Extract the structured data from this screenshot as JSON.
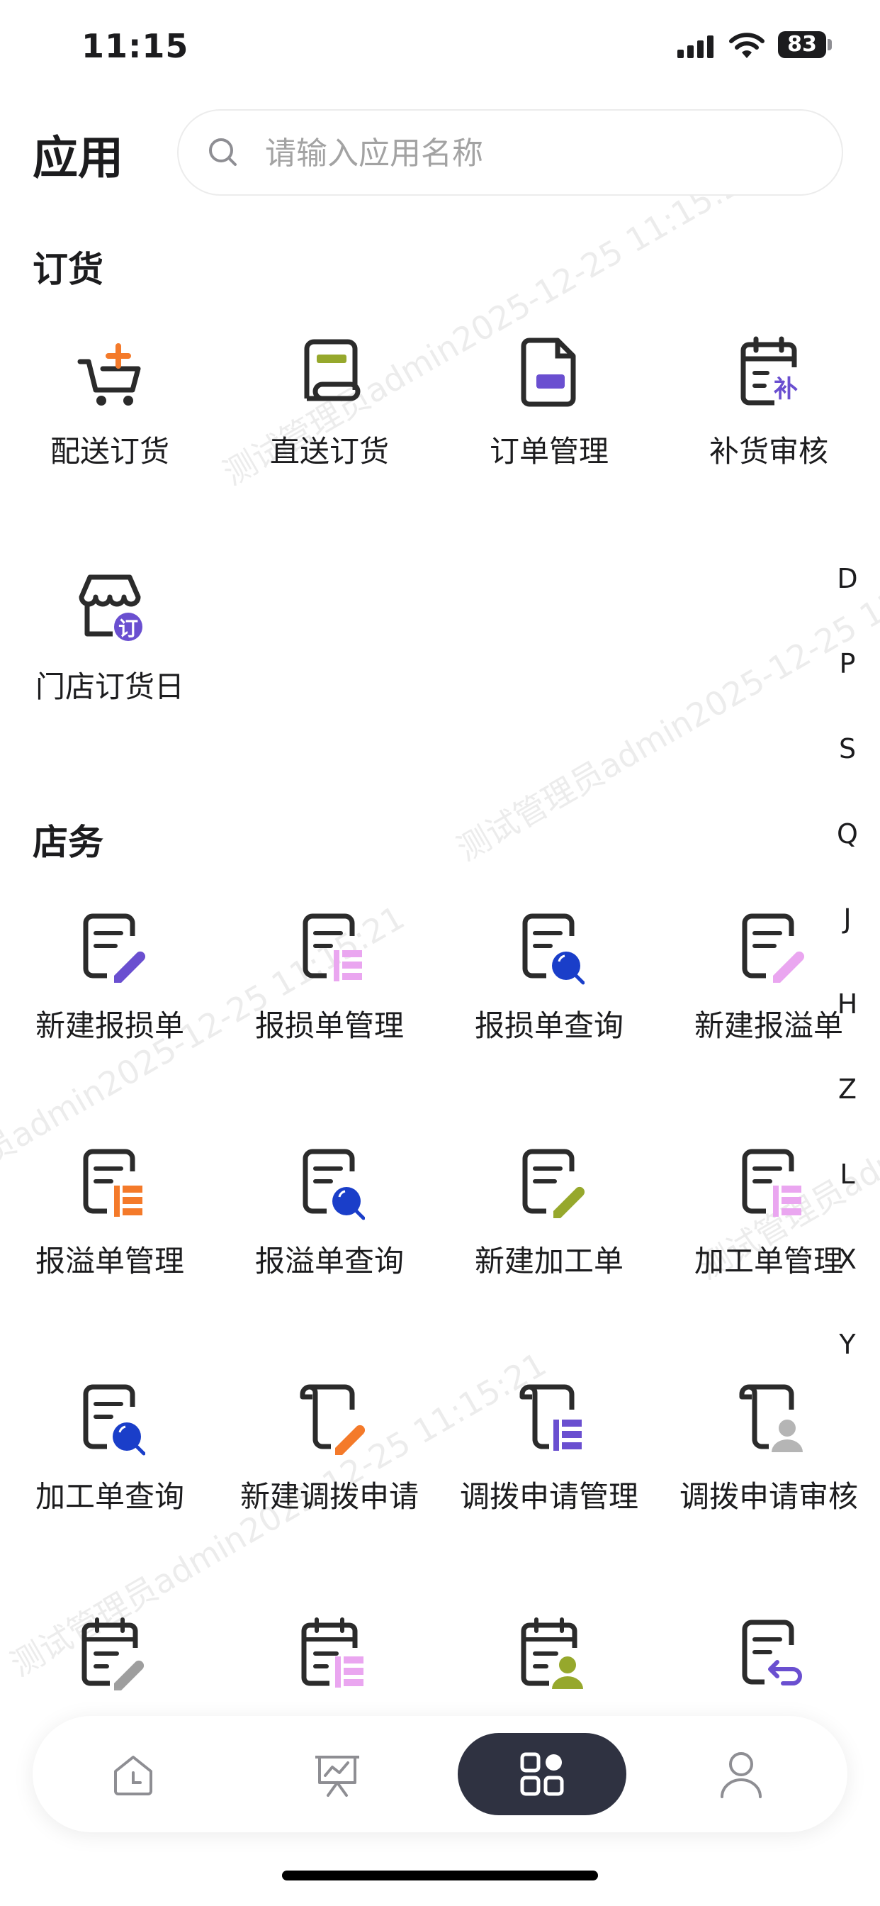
{
  "status_bar": {
    "time": "11:15",
    "battery": "83"
  },
  "header": {
    "title": "应用",
    "search_placeholder": "请输入应用名称"
  },
  "sections": [
    {
      "title": "订货",
      "apps": [
        "配送订货",
        "直送订货",
        "订单管理",
        "补货审核",
        "门店订货日"
      ]
    },
    {
      "title": "店务",
      "apps": [
        "新建报损单",
        "报损单管理",
        "报损单查询",
        "新建报溢单",
        "报溢单管理",
        "报溢单查询",
        "新建加工单",
        "加工单管理",
        "加工单查询",
        "新建调拨申请",
        "调拨申请管理",
        "调拨申请审核"
      ]
    }
  ],
  "icon_badges": {
    "replenish": "补",
    "order_day": "订"
  },
  "alphabet_index": [
    "D",
    "P",
    "S",
    "Q",
    "J",
    "H",
    "Z",
    "L",
    "X",
    "Y"
  ],
  "watermark": "测试管理员admin2025-12-25 11:15:21",
  "tab_bar": {
    "items": [
      "recent-icon",
      "dashboard-icon",
      "apps-grid-icon",
      "profile-icon"
    ],
    "active": "apps-grid-icon"
  },
  "colors": {
    "accent_purple": "#6a4fd0",
    "accent_orange": "#f47a2a",
    "accent_olive": "#96a82c",
    "accent_blue": "#1a3ec9",
    "accent_pink": "#eaa6f0",
    "dark": "#2f3241"
  }
}
